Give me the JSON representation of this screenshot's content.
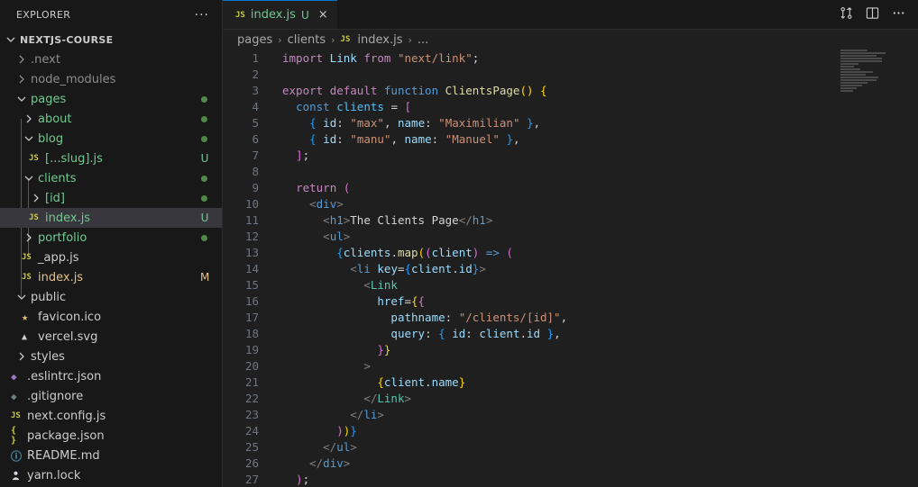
{
  "explorer": {
    "title": "EXPLORER",
    "more_label": "···",
    "root": "NEXTJS-COURSE",
    "items": [
      {
        "label": ".next",
        "badge": ""
      },
      {
        "label": "node_modules",
        "badge": ""
      },
      {
        "label": "pages",
        "badge": ""
      },
      {
        "label": "about",
        "badge": ""
      },
      {
        "label": "blog",
        "badge": ""
      },
      {
        "label": "[...slug].js",
        "badge": "U"
      },
      {
        "label": "clients",
        "badge": ""
      },
      {
        "label": "[id]",
        "badge": ""
      },
      {
        "label": "index.js",
        "badge": "U"
      },
      {
        "label": "portfolio",
        "badge": ""
      },
      {
        "label": "_app.js",
        "badge": ""
      },
      {
        "label": "index.js",
        "badge": "M"
      },
      {
        "label": "public",
        "badge": ""
      },
      {
        "label": "favicon.ico",
        "badge": ""
      },
      {
        "label": "vercel.svg",
        "badge": ""
      },
      {
        "label": "styles",
        "badge": ""
      },
      {
        "label": ".eslintrc.json",
        "badge": ""
      },
      {
        "label": ".gitignore",
        "badge": ""
      },
      {
        "label": "next.config.js",
        "badge": ""
      },
      {
        "label": "package.json",
        "badge": ""
      },
      {
        "label": "README.md",
        "badge": ""
      },
      {
        "label": "yarn.lock",
        "badge": ""
      }
    ]
  },
  "tab": {
    "icon": "JS",
    "name": "index.js",
    "status": "U",
    "close": "×"
  },
  "breadcrumb": {
    "items": [
      "pages",
      "clients",
      "index.js",
      "..."
    ],
    "file_icon": "JS"
  },
  "icons": {
    "js": "JS",
    "json": "{ }",
    "info": "ⓘ",
    "star": "★",
    "triangle": "▲",
    "dot": "◆"
  },
  "code": {
    "line_numbers": [
      "1",
      "2",
      "3",
      "4",
      "5",
      "6",
      "7",
      "8",
      "9",
      "10",
      "11",
      "12",
      "13",
      "14",
      "15",
      "16",
      "17",
      "18",
      "19",
      "20",
      "21",
      "22",
      "23",
      "24",
      "25",
      "26",
      "27"
    ],
    "tokens": {
      "l1": [
        "import",
        " Link ",
        "from",
        " ",
        "\"next/link\"",
        ";"
      ],
      "l3": [
        "export",
        " ",
        "default",
        " ",
        "function",
        " ",
        "ClientsPage",
        "()",
        " ",
        "{"
      ],
      "l4": [
        "const",
        " ",
        "clients",
        " = ",
        "["
      ],
      "l5": [
        "{",
        " ",
        "id",
        ": ",
        "\"max\"",
        ", ",
        "name",
        ": ",
        "\"Maximilian\"",
        " ",
        "}",
        ","
      ],
      "l6": [
        "{",
        " ",
        "id",
        ": ",
        "\"manu\"",
        ", ",
        "name",
        ": ",
        "\"Manuel\"",
        " ",
        "}",
        ","
      ],
      "l7": [
        "]",
        ";"
      ],
      "l9": [
        "return",
        " ",
        "("
      ],
      "l10": [
        "<",
        "div",
        ">"
      ],
      "l11": [
        "<",
        "h1",
        ">",
        "The Clients Page",
        "</",
        "h1",
        ">"
      ],
      "l12": [
        "<",
        "ul",
        ">"
      ],
      "l13": [
        "{",
        "clients",
        ".",
        "map",
        "(",
        "(",
        "client",
        ")",
        " => ",
        "("
      ],
      "l14": [
        "<",
        "li",
        " ",
        "key",
        "=",
        "{",
        "client",
        ".",
        "id",
        "}",
        ">"
      ],
      "l15": [
        "<",
        "Link"
      ],
      "l16": [
        "href",
        "=",
        "{",
        "{"
      ],
      "l17": [
        "pathname",
        ": ",
        "\"/clients/[id]\"",
        ","
      ],
      "l18": [
        "query",
        ": ",
        "{",
        " ",
        "id",
        ": ",
        "client",
        ".",
        "id",
        " ",
        "}",
        ","
      ],
      "l19": [
        "}",
        "}"
      ],
      "l20": [
        ">"
      ],
      "l21": [
        "{",
        "client",
        ".",
        "name",
        "}"
      ],
      "l22": [
        "</",
        "Link",
        ">"
      ],
      "l23": [
        "</",
        "li",
        ">"
      ],
      "l24": [
        ")",
        ")",
        "}"
      ],
      "l25": [
        "</",
        "ul",
        ">"
      ],
      "l26": [
        "</",
        "div",
        ">"
      ],
      "l27": [
        ")",
        ";"
      ]
    }
  }
}
